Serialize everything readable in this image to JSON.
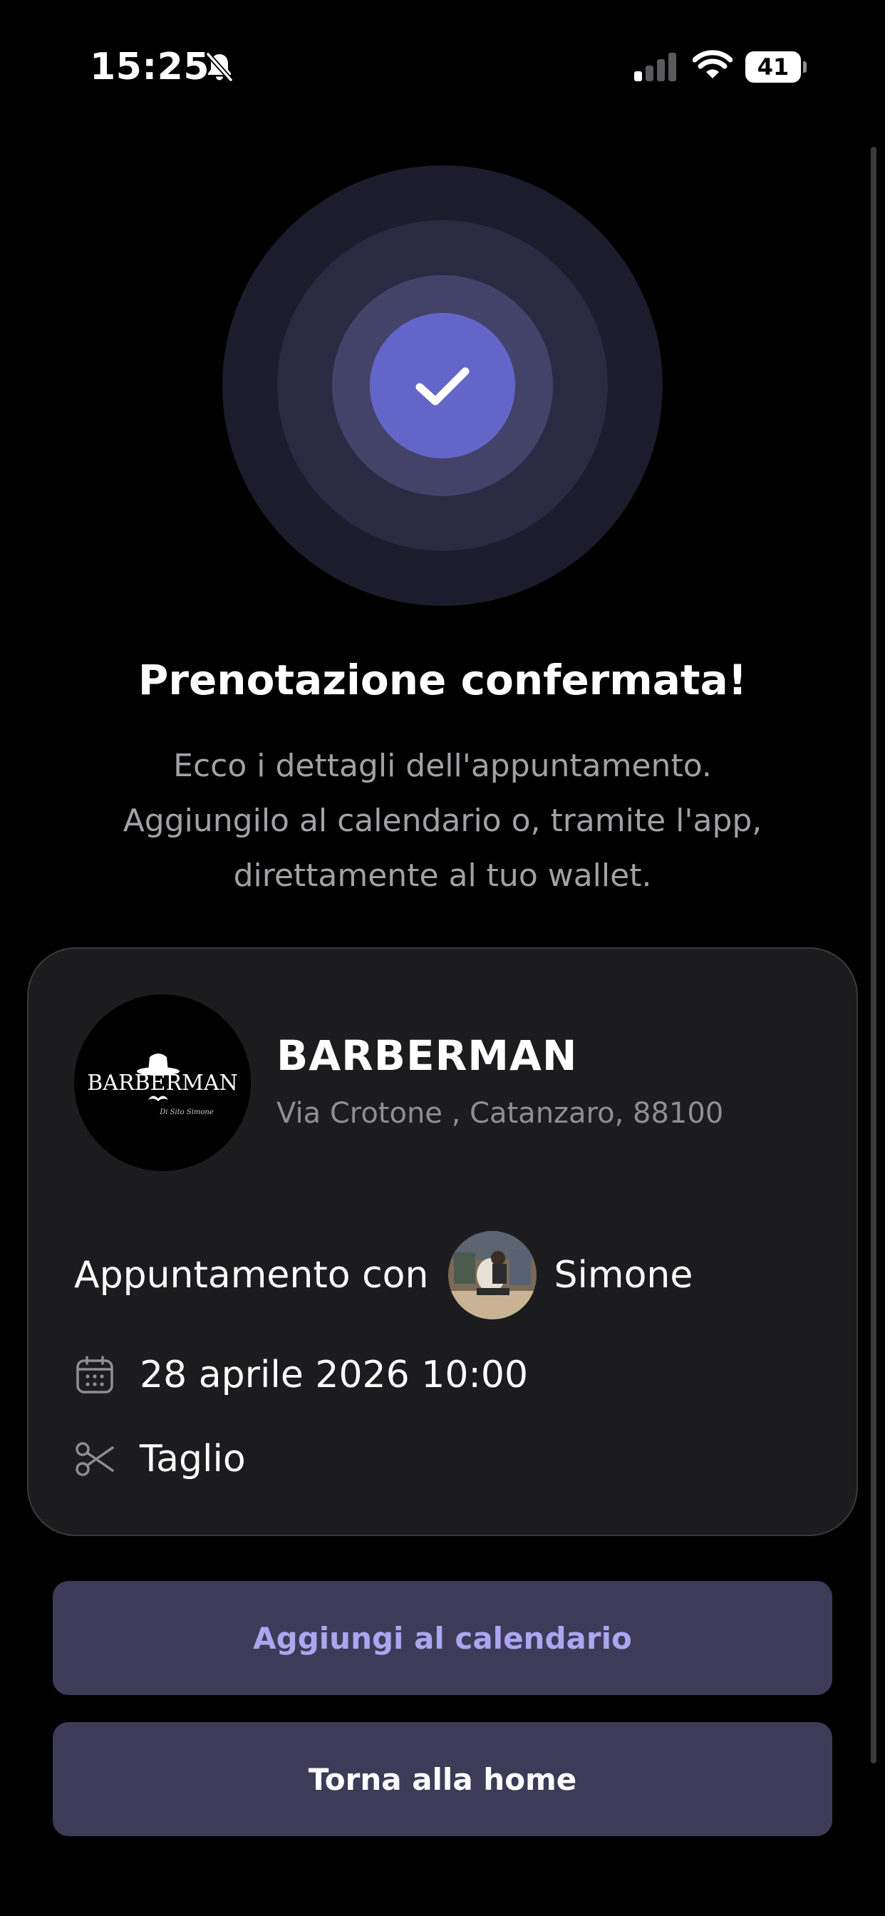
{
  "status_bar": {
    "time": "15:25",
    "battery_level": "41",
    "icons": [
      "bell-slash-icon",
      "cellular-signal-icon",
      "wifi-icon",
      "battery-icon"
    ]
  },
  "confirmation": {
    "icon": "check-icon",
    "title": "Prenotazione confermata!",
    "subtitle_lines": [
      "Ecco i dettagli dell'appuntamento.",
      "Aggiungilo al calendario o, tramite l'app,",
      "direttamente al tuo wallet."
    ]
  },
  "booking": {
    "shop": {
      "name": "BARBERMAN",
      "address": "Via Crotone , Catanzaro, 88100",
      "logo_text": "BARBERMAN",
      "logo_script": "Di Sito Simone"
    },
    "appointment_label": "Appuntamento con",
    "barber_name": "Simone",
    "date_time": "28 aprile 2026 10:00",
    "service": "Taglio",
    "icons": {
      "date": "calendar-icon",
      "service": "scissors-icon"
    }
  },
  "actions": {
    "add_calendar_label": "Aggiungi al calendario",
    "home_label": "Torna alla home"
  },
  "colors": {
    "background": "#000000",
    "card_background": "#1c1c1e",
    "accent": "#6366c8",
    "button_background": "#3d3b58",
    "button_accent_text": "#a9a7f0",
    "secondary_text": "#a1a1a6"
  }
}
